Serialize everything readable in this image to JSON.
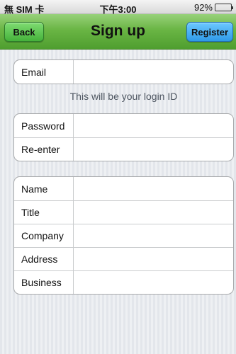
{
  "status_bar": {
    "carrier": "無 SIM 卡",
    "time": "下午3:00",
    "battery": "92%",
    "battery_level": 0.92
  },
  "nav": {
    "title": "Sign up",
    "back_label": "Back",
    "register_label": "Register"
  },
  "email_group": {
    "rows": [
      {
        "label": "Email",
        "value": ""
      }
    ],
    "hint": "This will be your login ID"
  },
  "password_group": {
    "rows": [
      {
        "label": "Password",
        "value": ""
      },
      {
        "label": "Re-enter",
        "value": ""
      }
    ]
  },
  "profile_group": {
    "rows": [
      {
        "label": "Name",
        "value": ""
      },
      {
        "label": "Title",
        "value": ""
      },
      {
        "label": "Company",
        "value": ""
      },
      {
        "label": "Address",
        "value": ""
      },
      {
        "label": "Business",
        "value": ""
      }
    ]
  },
  "colors": {
    "nav_green": "#6ab544",
    "back_button": "#45b23b",
    "register_button": "#2f9ae8",
    "background": "#e8eaee"
  },
  "icons": [
    "battery-icon"
  ]
}
